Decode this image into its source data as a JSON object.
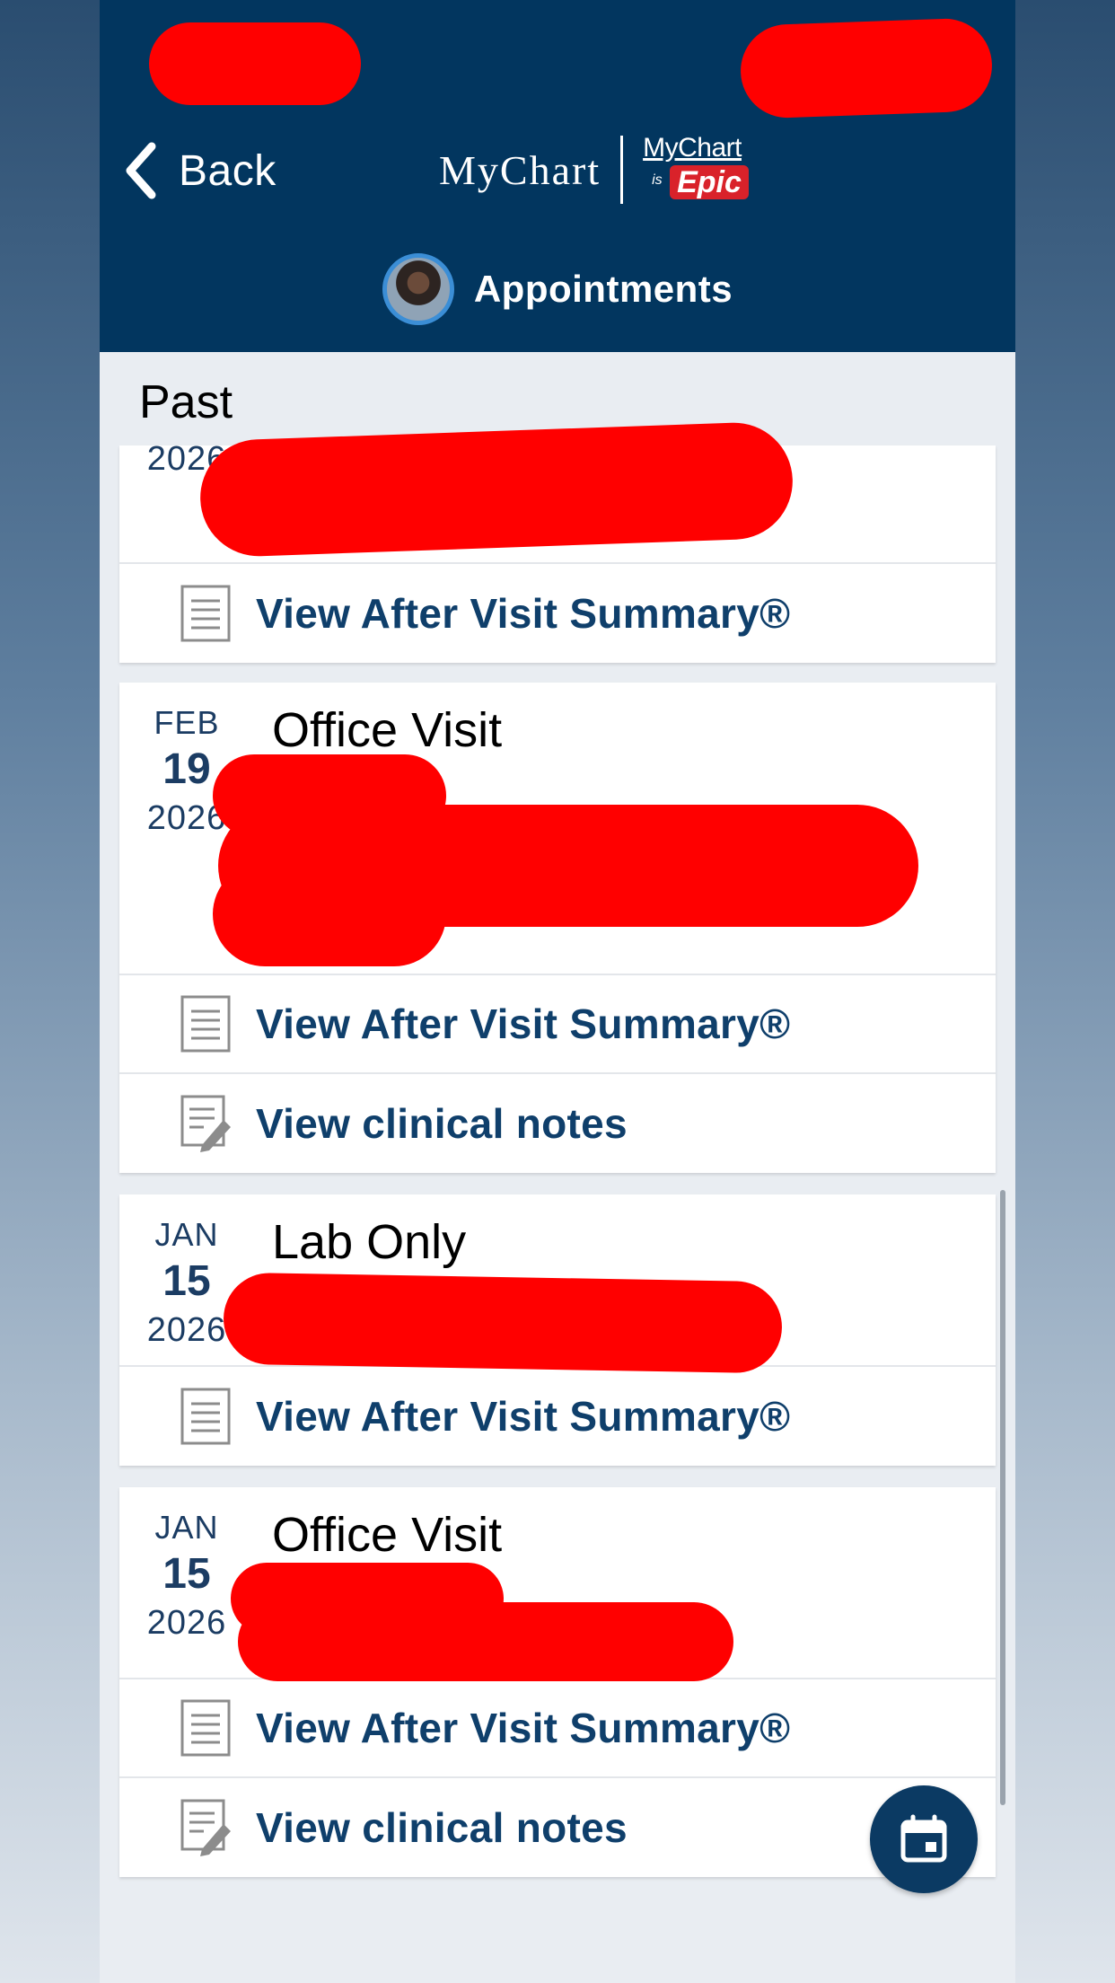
{
  "header": {
    "back_label": "Back",
    "logo": "MyChart",
    "badge_line1": "MyChart",
    "badge_is": "is",
    "badge_epic": "Epic",
    "page_title": "Appointments"
  },
  "section_label": "Past",
  "appointments": [
    {
      "month": "",
      "day": "",
      "year": "2026",
      "type": "",
      "actions": [
        "View After Visit Summary®"
      ]
    },
    {
      "month": "FEB",
      "day": "19",
      "year": "2026",
      "type": "Office Visit",
      "actions": [
        "View After Visit Summary®",
        "View clinical notes"
      ]
    },
    {
      "month": "JAN",
      "day": "15",
      "year": "2026",
      "type": "Lab Only",
      "actions": [
        "View After Visit Summary®"
      ]
    },
    {
      "month": "JAN",
      "day": "15",
      "year": "2026",
      "type": "Office Visit",
      "actions": [
        "View After Visit Summary®",
        "View clinical notes"
      ]
    }
  ],
  "icons": {
    "back": "chevron-left-icon",
    "summary": "document-icon",
    "notes": "edit-notes-icon",
    "fab": "calendar-icon"
  },
  "colors": {
    "header_bg": "#02365f",
    "link": "#0f3f6b",
    "redaction": "#ff0000"
  }
}
